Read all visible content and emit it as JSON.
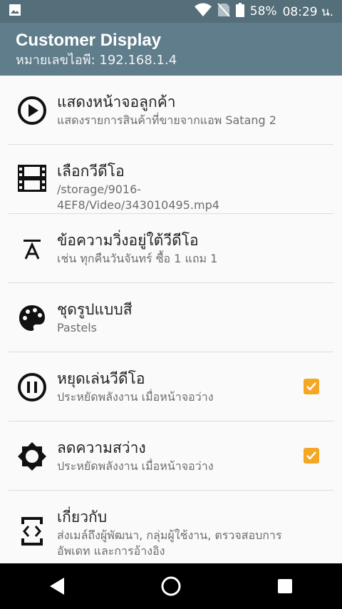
{
  "status_bar": {
    "battery_percent": "58%",
    "time": "08:29 น.",
    "icons": [
      "image-notification-icon",
      "wifi-icon",
      "no-sim-icon",
      "battery-icon"
    ]
  },
  "app_bar": {
    "title": "Customer Display",
    "subtitle": "หมายเลขไอพี: 192.168.1.4"
  },
  "settings": [
    {
      "icon": "play-circle-icon",
      "title": "แสดงหน้าจอลูกค้า",
      "summary": "แสดงรายการสินค้าที่ขายจากแอพ Satang 2"
    },
    {
      "icon": "film-icon",
      "title": "เลือกวีดีโอ",
      "summary": "/storage/9016-4EF8/Video/343010495.mp4"
    },
    {
      "icon": "text-format-icon",
      "title": "ข้อความวิ่งอยู่ใต้วีดีโอ",
      "summary": "เช่น ทุกคืนวันจันทร์ ซื้อ 1 แถม 1"
    },
    {
      "icon": "palette-icon",
      "title": "ชุดรูปแบบสี",
      "summary": "Pastels"
    },
    {
      "icon": "pause-circle-icon",
      "title": "หยุดเล่นวีดีโอ",
      "summary": "ประหยัดพลังงาน เมื่อหน้าจอว่าง",
      "checked": true
    },
    {
      "icon": "brightness-icon",
      "title": "ลดความสว่าง",
      "summary": "ประหยัดพลังงาน เมื่อหน้าจอว่าง",
      "checked": true
    },
    {
      "icon": "developer-mode-icon",
      "title": "เกี่ยวกับ",
      "summary": "ส่งเมล์ถึงผู้พัฒนา, กลุ่มผู้ใช้งาน, ตรวจสอบการอัพเดท และการอ้างอิง"
    }
  ],
  "nav_bar": {
    "buttons": [
      "back-icon",
      "home-icon",
      "recents-icon"
    ]
  },
  "colors": {
    "status_bar": "#546e7a",
    "app_bar": "#607d8b",
    "checkbox": "#f5a623"
  }
}
